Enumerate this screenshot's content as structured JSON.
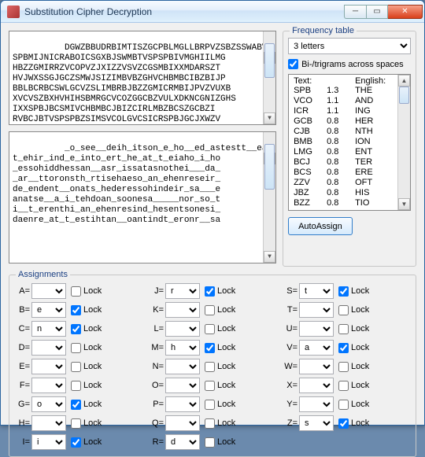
{
  "window": {
    "title": "Substitution Cipher Decryption",
    "minBtn": "─",
    "maxBtn": "▭",
    "closeBtn": "✕"
  },
  "cipherText": "DGWZBBUDRBIMTISZGCPBLMGLLBRPVZSBZSSWABVC\nSPBMIJNICRABOICSGXBJSWMBTVSPSPBIVMGHIILMG\nHBZZGMIRRZVCOPVZJXIZZVSVZCGSMBIXXMDARSZT\nHVJWXSSGJGCZSMWJSIZIMBVBZGHVCHBMBCIBZBIJP\nBBLBCRBCSWLGCVZSLIMBRBJBZZGMICRMBIJPVZVUXB\nXVCVSZBXHVHIHSBMRGCVCOZGGCBZVULXDKNCGNIZGHS\nIXXSPBJBCSMIVCHBMBCJBIZCIRLMBZBCSZGCBZI\nRVBCJBTVSPSPBZSIMSVCOLGVCSICRSPBJGCJXWZV",
  "plainText": "_o_see__deih_itson_e_ho__ed_astestt__ean\nt_ehir_ind_e_into_ert_he_at_t_eiaho_i_ho\n_essohiddhessan__asr_issatasnothei___da_\n_ar__ttoronsth_rtisehaeso_an_ehenreseir_\nde_endent__onats_hederessohindeir_sa___e\nanatse__a_i_tehdoan_soonesa_____nor_so_t\ni__t_erenthi_an_ehenresind_hesentsonesi_\ndaenre_at_t_estihtan__oantindt_eronr__sa",
  "freq": {
    "groupLabel": "Frequency table",
    "comboLabel": "3 letters",
    "bitriLabel": "Bi-/trigrams across spaces",
    "bitriChecked": true,
    "headers": {
      "text": "Text:",
      "english": "English:"
    },
    "rows": [
      {
        "t": "SPB",
        "r": "1.3",
        "e": "THE"
      },
      {
        "t": "VCO",
        "r": "1.1",
        "e": "AND"
      },
      {
        "t": "ICR",
        "r": "1.1",
        "e": "ING"
      },
      {
        "t": "GCB",
        "r": "0.8",
        "e": "HER"
      },
      {
        "t": "CJB",
        "r": "0.8",
        "e": "NTH"
      },
      {
        "t": "BMB",
        "r": "0.8",
        "e": "ION"
      },
      {
        "t": "LMG",
        "r": "0.8",
        "e": "ENT"
      },
      {
        "t": "BCJ",
        "r": "0.8",
        "e": "TER"
      },
      {
        "t": "BCS",
        "r": "0.8",
        "e": "ERE"
      },
      {
        "t": "ZZV",
        "r": "0.8",
        "e": "OFT"
      },
      {
        "t": "JBZ",
        "r": "0.8",
        "e": "HIS"
      },
      {
        "t": "BZZ",
        "r": "0.8",
        "e": "TIO"
      }
    ],
    "autoAssign": "AutoAssign"
  },
  "assignments": {
    "groupLabel": "Assignments",
    "lockLabel": "Lock",
    "items": [
      {
        "k": "A",
        "v": "",
        "lock": false
      },
      {
        "k": "B",
        "v": "e",
        "lock": true
      },
      {
        "k": "C",
        "v": "n",
        "lock": true
      },
      {
        "k": "D",
        "v": "",
        "lock": false
      },
      {
        "k": "E",
        "v": "",
        "lock": false
      },
      {
        "k": "F",
        "v": "",
        "lock": false
      },
      {
        "k": "G",
        "v": "o",
        "lock": true
      },
      {
        "k": "H",
        "v": "",
        "lock": false
      },
      {
        "k": "I",
        "v": "i",
        "lock": true
      },
      {
        "k": "J",
        "v": "r",
        "lock": true
      },
      {
        "k": "K",
        "v": "",
        "lock": false
      },
      {
        "k": "L",
        "v": "",
        "lock": false
      },
      {
        "k": "M",
        "v": "h",
        "lock": true
      },
      {
        "k": "N",
        "v": "",
        "lock": false
      },
      {
        "k": "O",
        "v": "",
        "lock": false
      },
      {
        "k": "P",
        "v": "",
        "lock": false
      },
      {
        "k": "Q",
        "v": "",
        "lock": false
      },
      {
        "k": "R",
        "v": "d",
        "lock": false
      },
      {
        "k": "S",
        "v": "t",
        "lock": true
      },
      {
        "k": "T",
        "v": "",
        "lock": false
      },
      {
        "k": "U",
        "v": "",
        "lock": false
      },
      {
        "k": "V",
        "v": "a",
        "lock": true
      },
      {
        "k": "W",
        "v": "",
        "lock": false
      },
      {
        "k": "X",
        "v": "",
        "lock": false
      },
      {
        "k": "Y",
        "v": "",
        "lock": false
      },
      {
        "k": "Z",
        "v": "s",
        "lock": true
      }
    ]
  }
}
